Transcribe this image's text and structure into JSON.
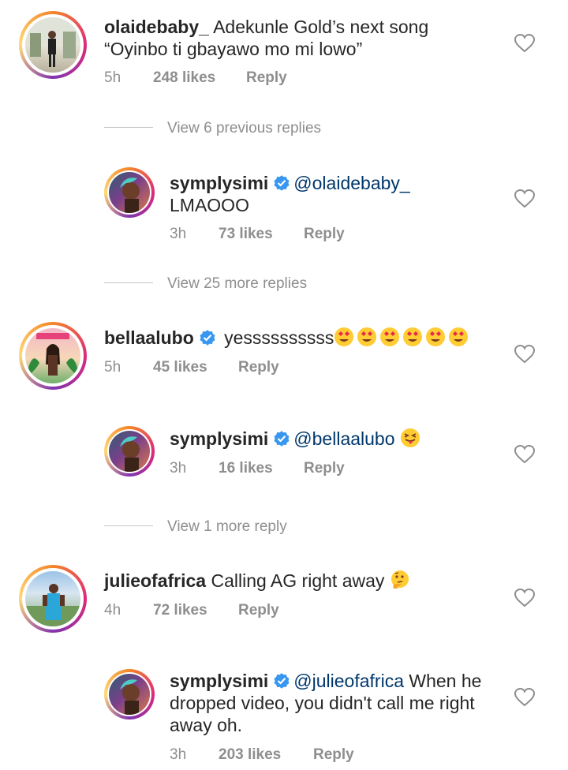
{
  "comments": [
    {
      "username": "olaidebaby_",
      "verified": false,
      "mention": "",
      "text_line1": "Adekunle Gold’s next song",
      "text_line2": "“Oyinbo ti gbayawo mo mi lowo”",
      "text_line3": "",
      "time": "5h",
      "likes": "248 likes",
      "reply": "Reply",
      "emoji": "",
      "view_replies": "View 6 previous replies"
    },
    {
      "username": "symplysimi",
      "verified": true,
      "mention": "@olaidebaby_",
      "text_line1": "",
      "text_line2": "LMAOOO",
      "text_line3": "",
      "time": "3h",
      "likes": "73 likes",
      "reply": "Reply",
      "emoji": "",
      "view_replies": "View 25 more replies"
    },
    {
      "username": "bellaalubo",
      "verified": true,
      "mention": "",
      "text_line1": "yessssssssss",
      "text_line2": "",
      "text_line3": "",
      "time": "5h",
      "likes": "45 likes",
      "reply": "Reply",
      "emoji": "heart-eyes x6",
      "view_replies": ""
    },
    {
      "username": "symplysimi",
      "verified": true,
      "mention": "@bellaalubo",
      "text_line1": "",
      "text_line2": "",
      "text_line3": "",
      "time": "3h",
      "likes": "16 likes",
      "reply": "Reply",
      "emoji": "squinting-tongue",
      "view_replies": "View 1 more reply"
    },
    {
      "username": "julieofafrica",
      "verified": false,
      "mention": "",
      "text_line1": "Calling AG right away",
      "text_line2": "",
      "text_line3": "",
      "time": "4h",
      "likes": "72 likes",
      "reply": "Reply",
      "emoji": "thinking",
      "view_replies": ""
    },
    {
      "username": "symplysimi",
      "verified": true,
      "mention": "@julieofafrica",
      "text_line1": "When he",
      "text_line2": "dropped video, you didn't call me right",
      "text_line3": "away oh.",
      "time": "3h",
      "likes": "203 likes",
      "reply": "Reply",
      "emoji": "",
      "view_replies": ""
    }
  ],
  "colors": {
    "text": "#262626",
    "secondary": "#8e8e8e",
    "mention": "#00376b",
    "verified_blue": "#3897f0",
    "story_ring": [
      "#f58529",
      "#dd2a7b",
      "#8134af",
      "#feda77"
    ]
  },
  "icons": {
    "like": "heart-outline-icon",
    "verified": "verified-badge-icon"
  }
}
